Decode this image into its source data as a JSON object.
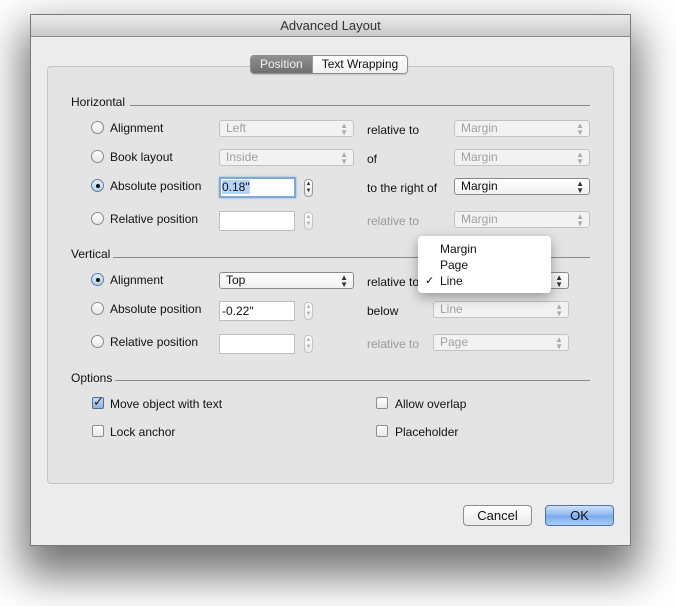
{
  "window": {
    "title": "Advanced Layout"
  },
  "tabs": [
    {
      "label": "Position",
      "active": true
    },
    {
      "label": "Text Wrapping",
      "active": false
    }
  ],
  "horizontal": {
    "section_label": "Horizontal",
    "rows": [
      {
        "radio_label": "Alignment",
        "selected": false,
        "control": "select",
        "value": "Left",
        "relation": "relative to",
        "relation_value": "Margin",
        "enabled": false
      },
      {
        "radio_label": "Book layout",
        "selected": false,
        "control": "select",
        "value": "Inside",
        "relation": "of",
        "relation_value": "Margin",
        "enabled": false
      },
      {
        "radio_label": "Absolute position",
        "selected": true,
        "control": "field",
        "value": "0.18\"",
        "relation": "to the right of",
        "relation_value": "Margin",
        "enabled": true
      },
      {
        "radio_label": "Relative position",
        "selected": false,
        "control": "field",
        "value": "",
        "relation": "relative to",
        "relation_value": "Margin",
        "enabled": false
      }
    ]
  },
  "vertical": {
    "section_label": "Vertical",
    "rows": [
      {
        "radio_label": "Alignment",
        "selected": true,
        "control": "select",
        "value": "Top",
        "relation": "relative to",
        "relation_value": "Line",
        "enabled": true
      },
      {
        "radio_label": "Absolute position",
        "selected": false,
        "control": "field",
        "value": "-0.22\"",
        "relation": "below",
        "relation_value": "Line",
        "enabled": false
      },
      {
        "radio_label": "Relative position",
        "selected": false,
        "control": "field",
        "value": "",
        "relation": "relative to",
        "relation_value": "Page",
        "enabled": false
      }
    ]
  },
  "dropdown_menu": {
    "items": [
      {
        "label": "Margin",
        "checked": false
      },
      {
        "label": "Page",
        "checked": false
      },
      {
        "label": "Line",
        "checked": true
      }
    ],
    "check_glyph": "✓"
  },
  "options": {
    "section_label": "Options",
    "checkboxes": [
      {
        "label": "Move object with text",
        "checked": true
      },
      {
        "label": "Allow overlap",
        "checked": false
      },
      {
        "label": "Lock anchor",
        "checked": false
      },
      {
        "label": "Placeholder",
        "checked": false
      }
    ]
  },
  "buttons": {
    "cancel": "Cancel",
    "ok": "OK"
  },
  "glyphs": {
    "select_arrows_up": "▲",
    "select_arrows_down": "▼",
    "check": "✓"
  }
}
